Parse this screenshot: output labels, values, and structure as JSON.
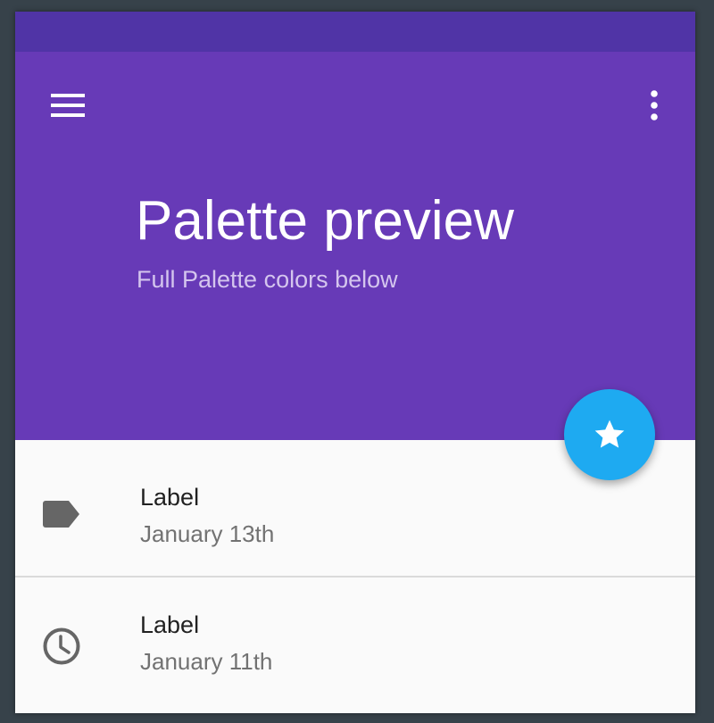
{
  "header": {
    "title": "Palette preview",
    "subtitle": "Full Palette colors below",
    "menu_icon": "menu-icon",
    "more_icon": "more-vert-icon"
  },
  "fab": {
    "icon": "star-icon"
  },
  "list": {
    "items": [
      {
        "icon": "label-icon",
        "label": "Label",
        "date": "January 13th"
      },
      {
        "icon": "clock-icon",
        "label": "Label",
        "date": "January 11th"
      }
    ]
  },
  "colors": {
    "background": "#37424a",
    "status_bar": "#5034a6",
    "primary": "#673ab7",
    "accent": "#1eaaf1",
    "surface": "#fafafa",
    "subtitle": "#d4c5ee",
    "primary_text": "#212121",
    "secondary_text": "#727272",
    "icon_grey": "#666666"
  }
}
